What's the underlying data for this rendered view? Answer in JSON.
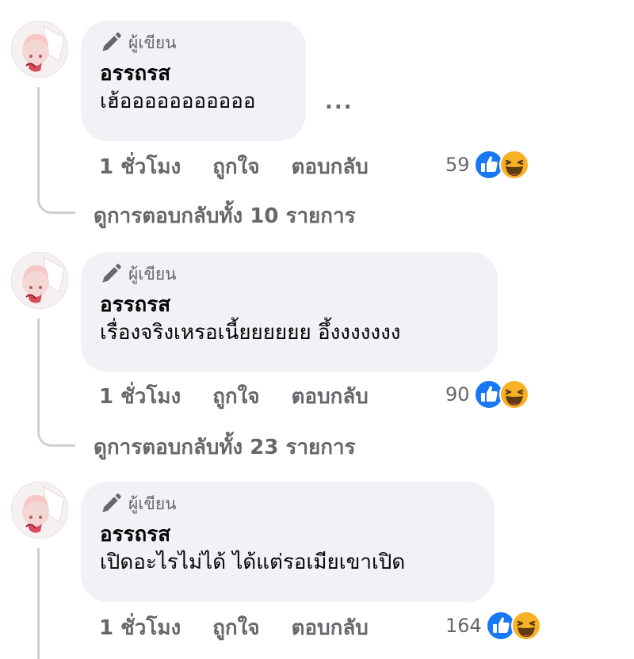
{
  "comments": [
    {
      "badge": "ผู้เขียน",
      "author": "อรรถรส",
      "text": "เฮ้อออออออออออ",
      "time": "1 ชั่วโมง",
      "like": "ถูกใจ",
      "reply": "ตอบกลับ",
      "reaction_count": "59",
      "more": "...",
      "view_replies": "ดูการตอบกลับทั้ง 10 รายการ"
    },
    {
      "badge": "ผู้เขียน",
      "author": "อรรถรส",
      "text": "เรื่องจริงเหรอเนี้ยยยยยย อึ้งงงงงงง",
      "time": "1 ชั่วโมง",
      "like": "ถูกใจ",
      "reply": "ตอบกลับ",
      "reaction_count": "90",
      "view_replies": "ดูการตอบกลับทั้ง 23 รายการ"
    },
    {
      "badge": "ผู้เขียน",
      "author": "อรรถรส",
      "text": "เปิดอะไรไม่ได้ ได้แต่รอเมียเขาเปิด",
      "time": "1 ชั่วโมง",
      "like": "ถูกใจ",
      "reply": "ตอบกลับ",
      "reaction_count": "164"
    }
  ],
  "icons": {
    "badge": "pencil-icon",
    "more": "ellipsis-icon",
    "reaction_1": "like-reaction-icon",
    "reaction_2": "haha-reaction-icon"
  },
  "colors": {
    "bubble": "#f0f2f5",
    "secondary_text": "#65676b",
    "like_blue": "#1877f2",
    "haha_yellow": "#f7b125",
    "thread_line": "#ced0d4"
  }
}
